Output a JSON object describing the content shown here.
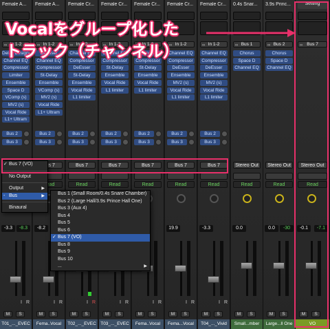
{
  "strips": [
    {
      "name": "Female A...",
      "input": "In 1-2",
      "plugins": [
        "Delay Designer",
        "Channel EQ",
        "Compressor",
        "Limiter",
        "Ensemble",
        "Space D",
        "VComp (s)",
        "MV2 (s)",
        "Vocal Ride",
        "L1+ Ultram"
      ],
      "sends": [
        "Bus 2",
        "Bus 3"
      ],
      "output": "Bus 7",
      "auto": "Read",
      "vol": "-3.3",
      "peak": "-8.3",
      "peak_color": "green",
      "pan_color": "grey",
      "fader": 0.3,
      "meter": 0,
      "ir": [
        "I",
        "R"
      ],
      "ms": [
        "M",
        "S"
      ],
      "track": "T01_..._EVEC",
      "color": "blue"
    },
    {
      "name": "Female A...",
      "input": "In 1-2",
      "plugins": [
        "DeEsser",
        "Channel EQ",
        "Compressor",
        "St-Delay",
        "Ensemble",
        "VComp (s)",
        "MV2 (s)",
        "Vocal Ride",
        "L1+ Ultram"
      ],
      "sends": [
        "Bus 2",
        "Bus 3"
      ],
      "output": "Bus 7",
      "auto": "Read",
      "vol": "-8.2",
      "peak": "",
      "peak_color": "green",
      "pan_color": "grey",
      "fader": 0.3,
      "meter": 0,
      "ir": [
        "I",
        "R"
      ],
      "ms": [
        "M",
        "S"
      ],
      "track": "Fema..Vocal",
      "color": "blue"
    },
    {
      "name": "Female Cr...",
      "input": "In 1-2",
      "plugins": [
        "Channel EQ",
        "Compressor",
        "DeEsser",
        "St-Delay",
        "Ensemble",
        "Vocal Ride",
        "L1 limiter"
      ],
      "sends": [
        "Bus 2",
        "Bus 3"
      ],
      "output": "Bus 7",
      "auto": "Read",
      "vol": "",
      "peak": "",
      "peak_color": "green",
      "pan_color": "grey",
      "fader": 0.5,
      "meter": 0.08,
      "ir": [
        "I",
        "R"
      ],
      "ms": [
        "M",
        "S"
      ],
      "track": "T02_..._EVEC",
      "color": "blue"
    },
    {
      "name": "Female Cr...",
      "input": "In 1-2",
      "plugins": [
        "Channel EQ",
        "Compressor",
        "St-Delay",
        "Ensemble",
        "Vocal Ride",
        "L1 limiter"
      ],
      "sends": [
        "Bus 2",
        "Bus 3"
      ],
      "output": "Bus 7",
      "auto": "Read",
      "vol": "",
      "peak": "",
      "peak_color": "green",
      "pan_color": "grey",
      "fader": 0.5,
      "meter": 0,
      "ir": [
        "I",
        "R"
      ],
      "ms": [
        "M",
        "S"
      ],
      "track": "T03_..._EVEC",
      "color": "blue"
    },
    {
      "name": "Female Cr...",
      "input": "In 1-2",
      "plugins": [
        "Channel EQ",
        "Compressor",
        "St-Delay",
        "Ensemble",
        "Vocal Ride",
        "L1 limiter"
      ],
      "sends": [
        "Bus 2",
        "Bus 3"
      ],
      "output": "Bus 7",
      "auto": "Read",
      "vol": "",
      "peak": "",
      "peak_color": "green",
      "pan_color": "grey",
      "fader": 0.5,
      "meter": 0,
      "ir": [
        "I",
        "R"
      ],
      "ms": [
        "M",
        "S"
      ],
      "track": "Fema..Vocal",
      "color": "blue"
    },
    {
      "name": "Female Cr...",
      "input": "In 1-2",
      "plugins": [
        "Channel EQ",
        "Compressor",
        "DeEsser",
        "Ensemble",
        "MV2 (s)",
        "Vocal Ride",
        "L1 limiter"
      ],
      "sends": [
        "Bus 2",
        "Bus 3"
      ],
      "output": "Bus 7",
      "auto": "Read",
      "vol": "19.9",
      "peak": "",
      "peak_color": "green",
      "pan_color": "grey",
      "fader": 0.5,
      "meter": 0,
      "ir": [
        "I",
        "R"
      ],
      "ms": [
        "M",
        "S"
      ],
      "track": "Fema...Vocal",
      "color": "blue"
    },
    {
      "name": "Female Cr...",
      "input": "In 1-2",
      "plugins": [
        "Channel EQ",
        "Compressor",
        "DeEsser",
        "Ensemble",
        "MV2 (s)",
        "Vocal Ride",
        "L1 limiter"
      ],
      "sends": [
        "Bus 2",
        "Bus 3"
      ],
      "output": "Bus 7",
      "auto": "Read",
      "vol": "-3.3",
      "peak": "",
      "peak_color": "green",
      "pan_color": "grey",
      "fader": 0.3,
      "meter": 0,
      "ir": [
        "I",
        "R"
      ],
      "ms": [
        "M",
        "S"
      ],
      "track": "T04_..._Vivid",
      "color": "blue"
    },
    {
      "name": "0.4s Snar...",
      "input": "Bus 1",
      "plugins": [
        "Chorus",
        "Space D",
        "Channel EQ"
      ],
      "sends": [],
      "output": "Stereo Out",
      "auto": "Read",
      "vol": "0.0",
      "peak": "",
      "peak_color": "green",
      "pan_color": "yellow",
      "fader": 0.55,
      "meter": 0,
      "ir": [],
      "ms": [
        "M",
        "S"
      ],
      "track": "Small...mber",
      "color": "green"
    },
    {
      "name": "3.9s Princ...",
      "input": "Bus 2",
      "plugins": [
        "Chorus",
        "Space D",
        "Channel EQ"
      ],
      "sends": [],
      "output": "Stereo Out",
      "auto": "Read",
      "vol": "0.0",
      "peak": "-30",
      "peak_color": "green",
      "pan_color": "yellow",
      "fader": 0.55,
      "meter": 0,
      "ir": [],
      "ms": [
        "M",
        "S"
      ],
      "track": "Large...ll One",
      "color": "green"
    },
    {
      "name": "Setting",
      "input": "Bus 7",
      "plugins": [],
      "sends": [],
      "output": "Stereo Out",
      "auto": "Read",
      "vol": "-0.1",
      "peak": "-7.1",
      "peak_color": "green",
      "pan_color": "yellow",
      "fader": 0.55,
      "meter": 0,
      "ir": [],
      "ms": [
        "M",
        "S"
      ],
      "track": "VO",
      "color": "yellow"
    }
  ],
  "output_menu": {
    "items": [
      {
        "label": "Bus 7  (VO)",
        "checked": true,
        "arrow": false
      },
      {
        "label": "No Output",
        "checked": false,
        "arrow": false
      },
      {
        "label": "Output",
        "checked": false,
        "arrow": true
      },
      {
        "label": "Bus",
        "checked": false,
        "arrow": true,
        "selected": true,
        "prefix": "-"
      },
      {
        "label": "Binaural",
        "checked": false,
        "arrow": false
      }
    ]
  },
  "bus_submenu": {
    "items": [
      {
        "label": "Bus 1  (Small Room/0.4s Snare Chamber)",
        "checked": false
      },
      {
        "label": "Bus 2  (Large Hall/3.9s Prince Hall One)",
        "checked": false
      },
      {
        "label": "Bus 3  (Aux 4)",
        "checked": false
      },
      {
        "label": "Bus 4",
        "checked": false
      },
      {
        "label": "Bus 5",
        "checked": false
      },
      {
        "label": "Bus 6",
        "checked": false
      },
      {
        "label": "Bus 7  (VO)",
        "checked": true,
        "selected": true
      },
      {
        "label": "Bus 8",
        "checked": false
      },
      {
        "label": "Bus 9",
        "checked": false
      },
      {
        "label": "Bus 10",
        "checked": false
      },
      {
        "label": "...",
        "checked": false,
        "arrow": true
      }
    ]
  },
  "annotation": {
    "line1": "Vocalをグループ化した",
    "line2": "トラック（チャンネル）"
  },
  "colors": {
    "highlight": "#e8306a",
    "plugin": "#304c82",
    "auto_read": "#6ad35e"
  }
}
